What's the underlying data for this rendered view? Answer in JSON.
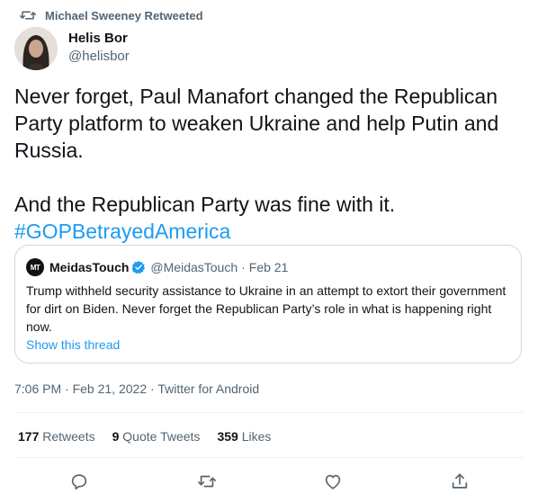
{
  "retweet": {
    "label": "Michael Sweeney Retweeted",
    "icon": "retweet-icon"
  },
  "author": {
    "name": "Helis Bor",
    "handle": "@helisbor",
    "avatar_icon": "avatar"
  },
  "tweet": {
    "line1": "Never forget, Paul Manafort changed the Republican Party platform to weaken Ukraine and help Putin and Russia.",
    "line2": "And the Republican Party was fine with it.",
    "hashtag": "#GOPBetrayedAmerica"
  },
  "quote": {
    "avatar_text": "MT",
    "name": "MeidasTouch",
    "verified_icon": "verified-badge-icon",
    "handle": "@MeidasTouch",
    "separator": "·",
    "date": "Feb 21",
    "text": "Trump withheld security assistance to Ukraine in an attempt to extort their government for dirt on Biden. Never forget the Republican Party’s role in what is happening right now.",
    "show_thread": "Show this thread"
  },
  "meta": {
    "time": "7:06 PM",
    "sep1": "·",
    "date": "Feb 21, 2022",
    "sep2": "·",
    "source": "Twitter for Android"
  },
  "stats": {
    "retweets": {
      "count": "177",
      "label": "Retweets"
    },
    "quotes": {
      "count": "9",
      "label": "Quote Tweets"
    },
    "likes": {
      "count": "359",
      "label": "Likes"
    }
  },
  "colors": {
    "accent": "#1d9bf0",
    "muted": "#536471",
    "text": "#0f1419",
    "border": "#cfd9de"
  },
  "actions": [
    "reply-icon",
    "retweet-icon",
    "like-icon",
    "share-icon"
  ]
}
